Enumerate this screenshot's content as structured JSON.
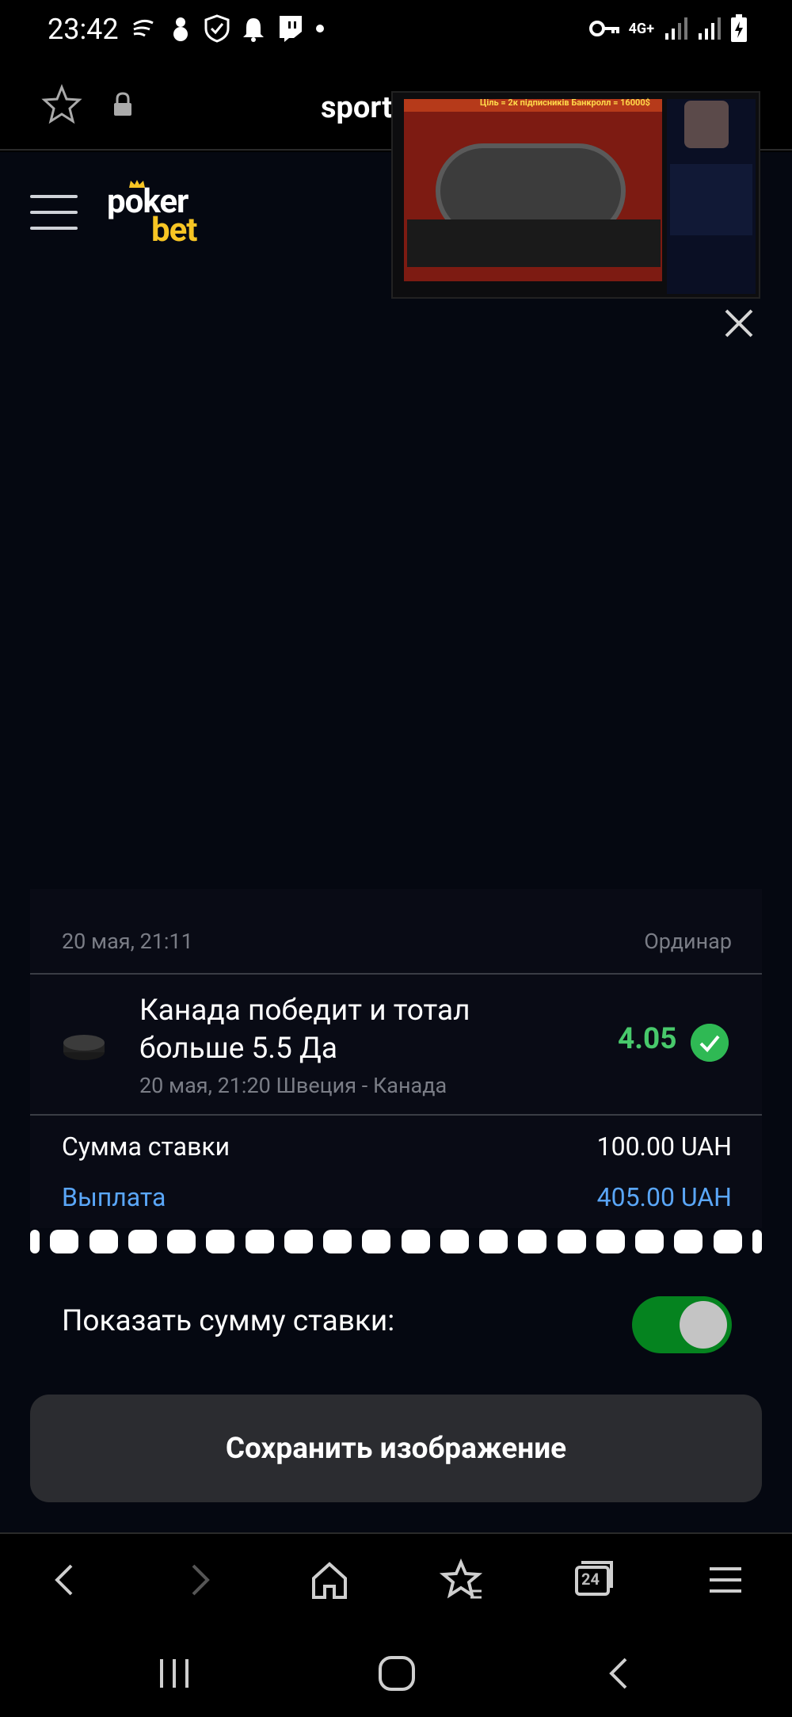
{
  "status_bar": {
    "time": "23:42",
    "network": "4G+"
  },
  "address_bar": {
    "url": "sport"
  },
  "site": {
    "logo_top": "poker",
    "logo_bottom": "bet"
  },
  "pip_video": {
    "top_text": "Ціль = 2к підписників     Банкролл = 16000$"
  },
  "bet_card": {
    "date": "20 мая, 21:11",
    "bet_type": "Ординар",
    "event_title": "Канада победит и тотал больше 5.5 Да",
    "event_subtitle": "20 мая, 21:20 Швеция - Канада",
    "odds": "4.05",
    "stake_label": "Сумма ставки",
    "stake_value": "100.00 UAH",
    "payout_label": "Выплата",
    "payout_value": "405.00 UAH"
  },
  "toggle": {
    "label": "Показать сумму ставки:",
    "state": "on"
  },
  "save_button": {
    "label": "Сохранить изображение"
  },
  "browser_toolbar": {
    "tab_count": "24"
  },
  "colors": {
    "accent_green": "#48c96b",
    "link_blue": "#5aa6f7",
    "logo_yellow": "#f7c524",
    "toggle_green": "#05831f"
  }
}
